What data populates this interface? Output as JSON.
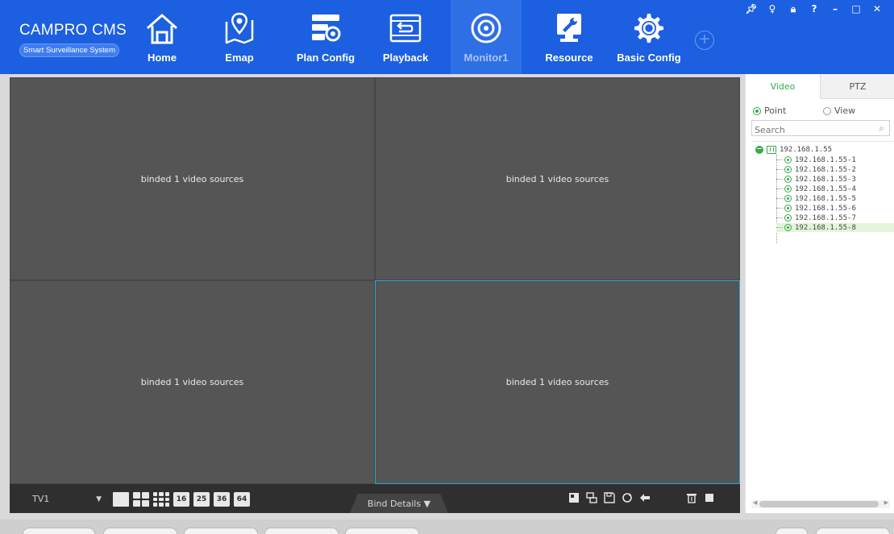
{
  "app": {
    "brand": "CAMPRO CMS",
    "tagline": "Smart Surveillance System"
  },
  "nav": {
    "items": [
      {
        "label": "Home",
        "icon": "home-icon"
      },
      {
        "label": "Emap",
        "icon": "map-pin-icon"
      },
      {
        "label": "Plan Config",
        "icon": "plan-config-icon"
      },
      {
        "label": "Playback",
        "icon": "playback-icon"
      },
      {
        "label": "Monitor1",
        "icon": "monitor-camera-icon",
        "active": true
      },
      {
        "label": "Resource",
        "icon": "wrench-icon"
      },
      {
        "label": "Basic Config",
        "icon": "gear-icon"
      }
    ],
    "add_label": "+"
  },
  "window_controls": [
    "pin",
    "user",
    "lock",
    "?",
    "–",
    "□",
    "✕"
  ],
  "video": {
    "panes": [
      {
        "text": "binded 1 video sources"
      },
      {
        "text": "binded 1 video sources"
      },
      {
        "text": "binded 1 video sources"
      },
      {
        "text": "binded 1 video sources",
        "selected": true
      }
    ]
  },
  "toolbar": {
    "tv_value": "TV1",
    "layouts": [
      "1",
      "4",
      "9",
      "16",
      "25",
      "36",
      "64"
    ],
    "bind_details": "Bind Details",
    "bind_caret": "▼",
    "actions": [
      "snapshot-icon",
      "screen-switch-icon",
      "save-icon",
      "refresh-icon",
      "back-icon",
      "delete-icon",
      "stop-icon"
    ]
  },
  "panel": {
    "tabs": [
      "Video",
      "PTZ"
    ],
    "active_tab": "Video",
    "radio_point": "Point",
    "radio_view": "View",
    "search_placeholder": "Search",
    "tree": {
      "root": "192.168.1.55",
      "children": [
        "192.168.1.55-1",
        "192.168.1.55-2",
        "192.168.1.55-3",
        "192.168.1.55-4",
        "192.168.1.55-5",
        "192.168.1.55-6",
        "192.168.1.55-7",
        "192.168.1.55-8"
      ],
      "highlighted": "192.168.1.55-8"
    }
  },
  "colors": {
    "header": "#1c5fe0",
    "accent_green": "#39a84a",
    "selected_pane": "#2aa5d6"
  }
}
